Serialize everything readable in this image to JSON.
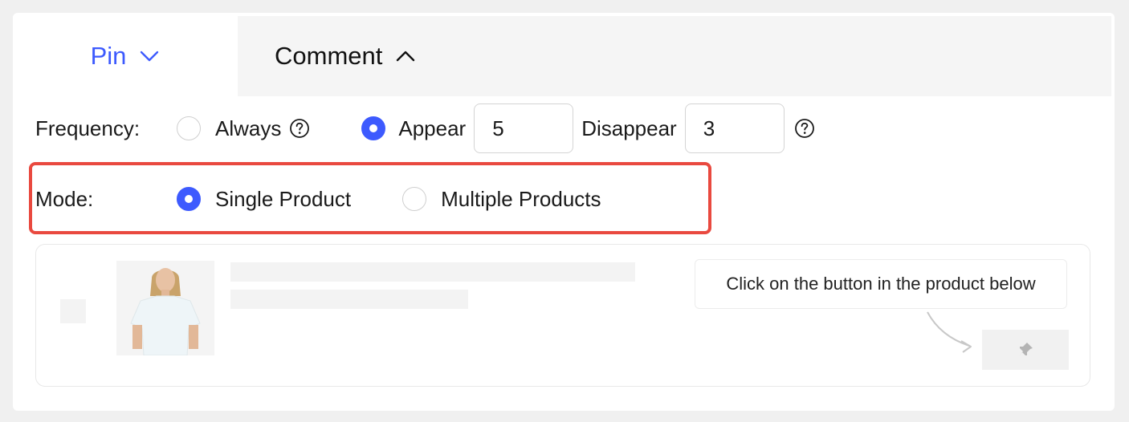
{
  "tabs": [
    {
      "label": "Pin",
      "active": true,
      "chevron": "chevron-down-icon"
    },
    {
      "label": "Comment",
      "active": false,
      "chevron": "chevron-up-icon"
    }
  ],
  "frequency": {
    "label": "Frequency:",
    "options": {
      "always": "Always",
      "appear": "Appear",
      "disappear": "Disappear"
    },
    "selected": "Appear",
    "appear_value": "5",
    "disappear_value": "3"
  },
  "mode": {
    "label": "Mode:",
    "options": {
      "single": "Single Product",
      "multiple": "Multiple Products"
    },
    "selected": "Single Product"
  },
  "preview": {
    "tooltip": "Click on the button in the product below",
    "button_icon": "pin-icon"
  },
  "colors": {
    "accent": "#3d5afe",
    "highlight_border": "#e9493f"
  }
}
